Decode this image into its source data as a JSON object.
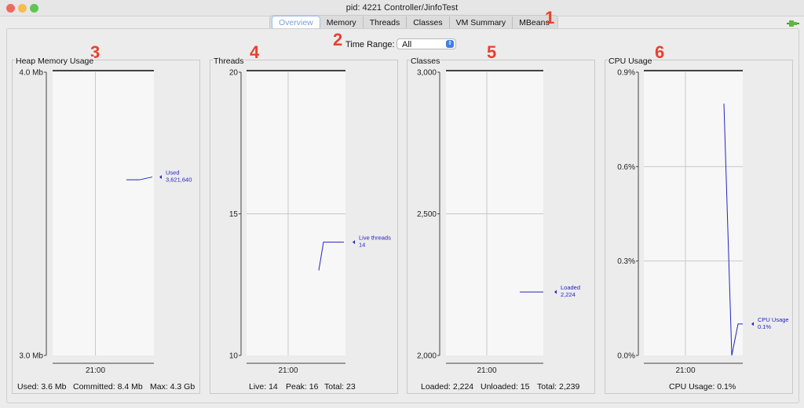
{
  "window": {
    "title": "pid: 4221 Controller/JinfoTest"
  },
  "tabs": [
    {
      "label": "Overview",
      "active": true
    },
    {
      "label": "Memory"
    },
    {
      "label": "Threads"
    },
    {
      "label": "Classes"
    },
    {
      "label": "VM Summary"
    },
    {
      "label": "MBeans"
    }
  ],
  "annotations": [
    "1",
    "2",
    "3",
    "4",
    "5",
    "6"
  ],
  "time_range": {
    "label": "Time Range:",
    "value": "All"
  },
  "panels": [
    {
      "title": "Heap Memory Usage",
      "footer": [
        "Used: 3.6 Mb",
        "Committed: 8.4 Mb",
        "Max: 4.3 Gb"
      ]
    },
    {
      "title": "Threads",
      "footer": [
        "Live: 14",
        "Peak: 16",
        "Total: 23"
      ]
    },
    {
      "title": "Classes",
      "footer": [
        "Loaded: 2,224",
        "Unloaded: 15",
        "Total: 2,239"
      ]
    },
    {
      "title": "CPU Usage",
      "footer": [
        "CPU Usage: 0.1%"
      ]
    }
  ],
  "colors": {
    "series": "#2323c8",
    "grid": "#c8c8c8",
    "annotation": "#e8402f"
  },
  "chart_data": [
    {
      "type": "line",
      "title": "Heap Memory Usage",
      "y_ticks": [
        "4.0 Mb",
        "3.0 Mb"
      ],
      "ylim": [
        3.0,
        4.0
      ],
      "x_ticks": [
        "21:00"
      ],
      "series": [
        {
          "name": "Used",
          "label": "Used",
          "value_label": "3,621,640",
          "values": [
            3.62,
            3.62,
            3.63
          ]
        }
      ]
    },
    {
      "type": "line",
      "title": "Threads",
      "y_ticks": [
        "20",
        "15",
        "10"
      ],
      "ylim": [
        10,
        20
      ],
      "x_ticks": [
        "21:00"
      ],
      "series": [
        {
          "name": "Live threads",
          "label": "Live threads",
          "value_label": "14",
          "values": [
            13,
            14,
            14,
            14
          ]
        }
      ]
    },
    {
      "type": "line",
      "title": "Classes",
      "y_ticks": [
        "3,000",
        "2,500",
        "2,000"
      ],
      "ylim": [
        2000,
        3000
      ],
      "x_ticks": [
        "21:00"
      ],
      "series": [
        {
          "name": "Loaded",
          "label": "Loaded",
          "value_label": "2,224",
          "values": [
            2224,
            2224
          ]
        }
      ]
    },
    {
      "type": "line",
      "title": "CPU Usage",
      "y_ticks": [
        "0.9%",
        "0.6%",
        "0.3%",
        "0.0%"
      ],
      "ylim": [
        0.0,
        0.9
      ],
      "x_ticks": [
        "21:00"
      ],
      "series": [
        {
          "name": "CPU Usage",
          "label": "CPU Usage",
          "value_label": "0.1%",
          "values": [
            0.8,
            0.0,
            0.1,
            0.1
          ]
        }
      ]
    }
  ]
}
